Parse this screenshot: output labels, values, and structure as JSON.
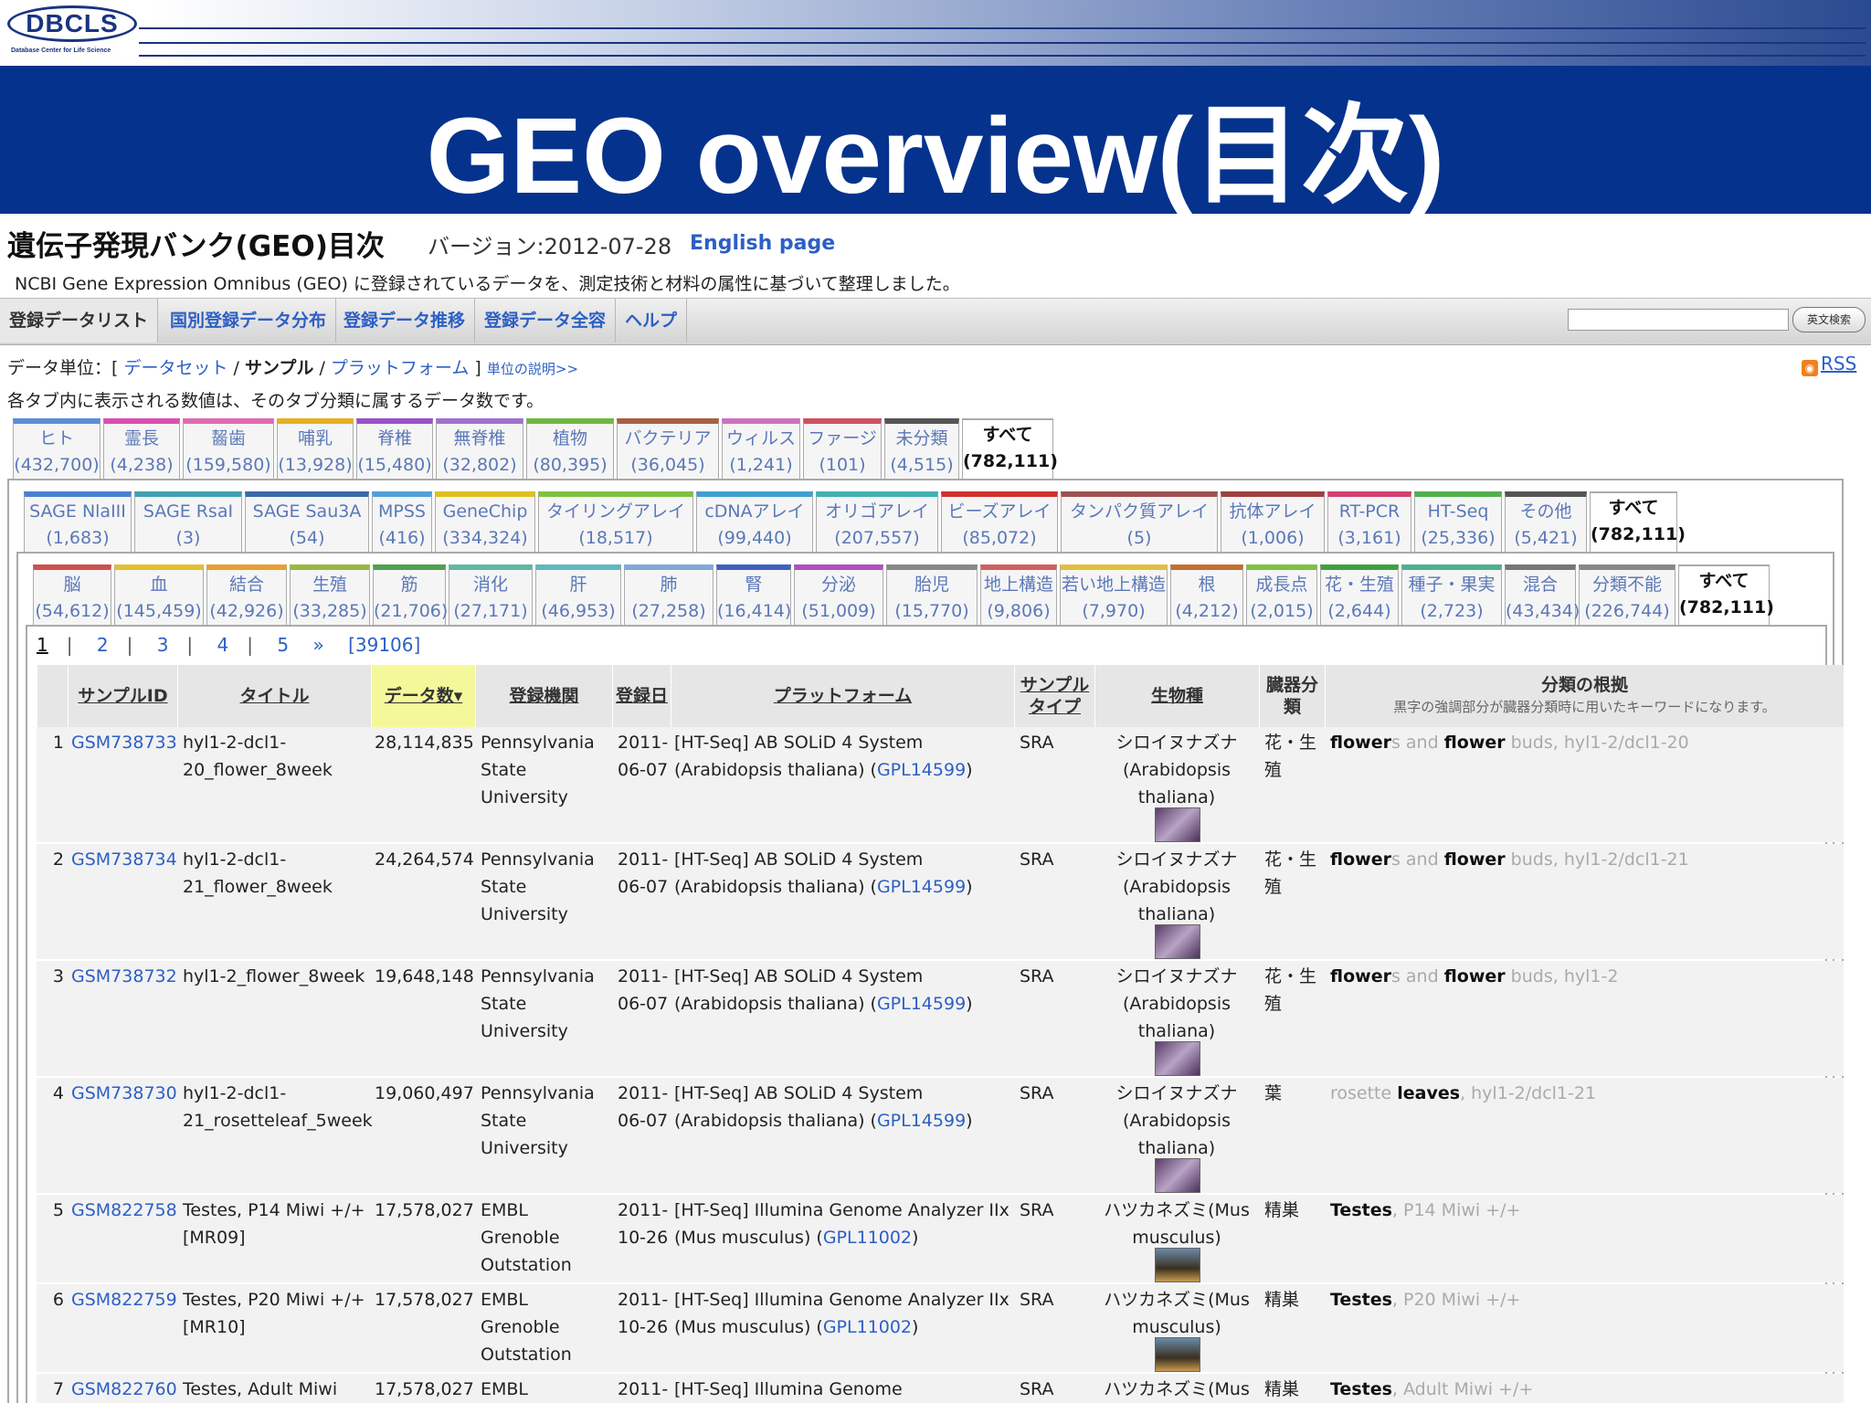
{
  "slide": {
    "logo_text": "DBCLS",
    "logo_sub": "Database Center for Life Science",
    "title": "GEO overview(目次)"
  },
  "page": {
    "heading": "遺伝子発現バンク(GEO)目次",
    "version": "バージョン:2012-07-28",
    "english_link": "English page",
    "description": "NCBI Gene Expression Omnibus (GEO) に登録されているデータを、測定技術と材料の属性に基づいて整理しました。",
    "nav": [
      "登録データリスト",
      "国別登録データ分布",
      "登録データ推移",
      "登録データ全容",
      "ヘルプ"
    ],
    "search_button": "英文検索",
    "unit_prefix": "データ単位：[",
    "unit_dataset": "データセット",
    "unit_slash1": "/",
    "unit_sample": "サンプル",
    "unit_slash2": "/",
    "unit_platform": "プラットフォーム",
    "unit_suffix": "]",
    "unit_help": "単位の説明>>",
    "rss": "RSS",
    "note": "各タブ内に表示される数値は、そのタブ分類に属するデータ数です。"
  },
  "organism_tabs": [
    {
      "label": "ヒト",
      "count": "(432,700)",
      "color": "#5b8ed6"
    },
    {
      "label": "霊長",
      "count": "(4,238)",
      "color": "#d94fb0"
    },
    {
      "label": "齧歯",
      "count": "(159,580)",
      "color": "#e06ab0"
    },
    {
      "label": "哺乳",
      "count": "(13,928)",
      "color": "#e8b020"
    },
    {
      "label": "脊椎",
      "count": "(15,480)",
      "color": "#9a50c8"
    },
    {
      "label": "無脊椎",
      "count": "(32,802)",
      "color": "#a070d0"
    },
    {
      "label": "植物",
      "count": "(80,395)",
      "color": "#70b840"
    },
    {
      "label": "バクテリア",
      "count": "(36,045)",
      "color": "#a86040"
    },
    {
      "label": "ウィルス",
      "count": "(1,241)",
      "color": "#d070c0"
    },
    {
      "label": "ファージ",
      "count": "(101)",
      "color": "#d05060"
    },
    {
      "label": "未分類",
      "count": "(4,515)",
      "color": "#555555"
    },
    {
      "label": "すべて",
      "count": "(782,111)",
      "color": "#aaaaaa"
    }
  ],
  "tech_tabs": [
    {
      "label": "SAGE NlaIII",
      "count": "(1,683)",
      "color": "#4a7fd0"
    },
    {
      "label": "SAGE RsaI",
      "count": "(3)",
      "color": "#40a0b0"
    },
    {
      "label": "SAGE Sau3A",
      "count": "(54)",
      "color": "#3a6aa8"
    },
    {
      "label": "MPSS",
      "count": "(416)",
      "color": "#50a0d8"
    },
    {
      "label": "GeneChip",
      "count": "(334,324)",
      "color": "#e0c020"
    },
    {
      "label": "タイリングアレイ",
      "count": "(18,517)",
      "color": "#80c040"
    },
    {
      "label": "cDNAアレイ",
      "count": "(99,440)",
      "color": "#40a0d0"
    },
    {
      "label": "オリゴアレイ",
      "count": "(207,557)",
      "color": "#40b0b0"
    },
    {
      "label": "ビーズアレイ",
      "count": "(85,072)",
      "color": "#d03030"
    },
    {
      "label": "タンパク質アレイ",
      "count": "(5)",
      "color": "#a05050"
    },
    {
      "label": "抗体アレイ",
      "count": "(1,006)",
      "color": "#a04040"
    },
    {
      "label": "RT-PCR",
      "count": "(3,161)",
      "color": "#d04070"
    },
    {
      "label": "HT-Seq",
      "count": "(25,336)",
      "color": "#50b050"
    },
    {
      "label": "その他",
      "count": "(5,421)",
      "color": "#555555"
    },
    {
      "label": "すべて",
      "count": "(782,111)",
      "color": "#aaaaaa"
    }
  ],
  "tissue_tabs": [
    {
      "label": "脳",
      "count": "(54,612)",
      "color": "#d05050"
    },
    {
      "label": "血",
      "count": "(145,459)",
      "color": "#e0c030"
    },
    {
      "label": "結合",
      "count": "(42,926)",
      "color": "#e8a030"
    },
    {
      "label": "生殖",
      "count": "(33,285)",
      "color": "#9ab840"
    },
    {
      "label": "筋",
      "count": "(21,706)",
      "color": "#50a050"
    },
    {
      "label": "消化",
      "count": "(27,171)",
      "color": "#60b8a0"
    },
    {
      "label": "肝",
      "count": "(46,953)",
      "color": "#60b8c0"
    },
    {
      "label": "肺",
      "count": "(27,258)",
      "color": "#80a8d8"
    },
    {
      "label": "腎",
      "count": "(16,414)",
      "color": "#4060c0"
    },
    {
      "label": "分泌",
      "count": "(51,009)",
      "color": "#b050c0"
    },
    {
      "label": "胎児",
      "count": "(15,770)",
      "color": "#888888"
    },
    {
      "label": "地上構造",
      "count": "(9,806)",
      "color": "#d06060"
    },
    {
      "label": "若い地上構造",
      "count": "(7,970)",
      "color": "#e0c040"
    },
    {
      "label": "根",
      "count": "(4,212)",
      "color": "#c07030"
    },
    {
      "label": "成長点",
      "count": "(2,015)",
      "color": "#80c040"
    },
    {
      "label": "花・生殖",
      "count": "(2,644)",
      "color": "#40a040"
    },
    {
      "label": "種子・果実",
      "count": "(2,723)",
      "color": "#50b090"
    },
    {
      "label": "混合",
      "count": "(43,434)",
      "color": "#777777"
    },
    {
      "label": "分類不能",
      "count": "(226,744)",
      "color": "#888888"
    },
    {
      "label": "すべて",
      "count": "(782,111)",
      "color": "#aaaaaa"
    }
  ],
  "pager": {
    "p1": "1",
    "sep": "|",
    "p2": "2",
    "p3": "3",
    "p4": "4",
    "p5": "5",
    "next": "»",
    "total": "[39106]"
  },
  "columns": {
    "sample_id": "サンプルID",
    "title": "タイトル",
    "data_count": "データ数",
    "sort_arrow": "▾",
    "institution": "登録機関",
    "date": "登録日",
    "platform": "プラットフォーム",
    "sample_type": "サンプルタイプ",
    "organism": "生物種",
    "organ": "臓器分類",
    "basis": "分類の根拠",
    "basis_note": "黒字の強調部分が臓器分類時に用いたキーワードになります。"
  },
  "rows": [
    {
      "n": "1",
      "id": "GSM738733",
      "title": "hyl1-2-dcl1-20_flower_8week",
      "count": "28,114,835",
      "inst": "Pennsylvania State University",
      "date": "2011-06-07",
      "platform_pre": "[HT-Seq] AB SOLiD 4 System (Arabidopsis thaliana) (",
      "platform_id": "GPL14599",
      "platform_post": ")",
      "stype": "SRA",
      "org": "シロイヌナズナ (Arabidopsis thaliana)",
      "organ": "花・生殖",
      "b1": "flower",
      "b2": "s and ",
      "b3": "flower",
      "b4": " buds, hyl1-2/dcl1-20",
      "thumb": "plant"
    },
    {
      "n": "2",
      "id": "GSM738734",
      "title": "hyl1-2-dcl1-21_flower_8week",
      "count": "24,264,574",
      "inst": "Pennsylvania State University",
      "date": "2011-06-07",
      "platform_pre": "[HT-Seq] AB SOLiD 4 System (Arabidopsis thaliana) (",
      "platform_id": "GPL14599",
      "platform_post": ")",
      "stype": "SRA",
      "org": "シロイヌナズナ (Arabidopsis thaliana)",
      "organ": "花・生殖",
      "b1": "flower",
      "b2": "s and ",
      "b3": "flower",
      "b4": " buds, hyl1-2/dcl1-21",
      "thumb": "plant"
    },
    {
      "n": "3",
      "id": "GSM738732",
      "title": "hyl1-2_flower_8week",
      "count": "19,648,148",
      "inst": "Pennsylvania State University",
      "date": "2011-06-07",
      "platform_pre": "[HT-Seq] AB SOLiD 4 System (Arabidopsis thaliana) (",
      "platform_id": "GPL14599",
      "platform_post": ")",
      "stype": "SRA",
      "org": "シロイヌナズナ (Arabidopsis thaliana)",
      "organ": "花・生殖",
      "b1": "flower",
      "b2": "s and ",
      "b3": "flower",
      "b4": " buds, hyl1-2",
      "thumb": "plant"
    },
    {
      "n": "4",
      "id": "GSM738730",
      "title": "hyl1-2-dcl1-21_rosetteleaf_5week",
      "count": "19,060,497",
      "inst": "Pennsylvania State University",
      "date": "2011-06-07",
      "platform_pre": "[HT-Seq] AB SOLiD 4 System (Arabidopsis thaliana) (",
      "platform_id": "GPL14599",
      "platform_post": ")",
      "stype": "SRA",
      "org": "シロイヌナズナ (Arabidopsis thaliana)",
      "organ": "葉",
      "b1": "",
      "b2": "rosette ",
      "b3": "leaves",
      "b4": ", hyl1-2/dcl1-21",
      "thumb": "plant"
    },
    {
      "n": "5",
      "id": "GSM822758",
      "title": "Testes, P14 Miwi +/+ [MR09]",
      "count": "17,578,027",
      "inst": "EMBL Grenoble Outstation",
      "date": "2011-10-26",
      "platform_pre": "[HT-Seq] Illumina Genome Analyzer IIx (Mus musculus) (",
      "platform_id": "GPL11002",
      "platform_post": ")",
      "stype": "SRA",
      "org": "ハツカネズミ(Mus musculus)",
      "organ": "精巣",
      "b1": "Testes",
      "b2": ", P14 Miwi +/+",
      "b3": "",
      "b4": "",
      "thumb": "mouse"
    },
    {
      "n": "6",
      "id": "GSM822759",
      "title": "Testes, P20 Miwi +/+ [MR10]",
      "count": "17,578,027",
      "inst": "EMBL Grenoble Outstation",
      "date": "2011-10-26",
      "platform_pre": "[HT-Seq] Illumina Genome Analyzer IIx (Mus musculus) (",
      "platform_id": "GPL11002",
      "platform_post": ")",
      "stype": "SRA",
      "org": "ハツカネズミ(Mus musculus)",
      "organ": "精巣",
      "b1": "Testes",
      "b2": ", P20 Miwi +/+",
      "b3": "",
      "b4": "",
      "thumb": "mouse"
    },
    {
      "n": "7",
      "id": "GSM822760",
      "title": "Testes, Adult Miwi",
      "count": "17,578,027",
      "inst": "EMBL",
      "date": "2011-",
      "platform_pre": "[HT-Seq] Illumina Genome",
      "platform_id": "",
      "platform_post": "",
      "stype": "SRA",
      "org": "ハツカネズミ(Mus",
      "organ": "精巣",
      "b1": "Testes",
      "b2": ", Adult Miwi +/+",
      "b3": "",
      "b4": "",
      "thumb": "none"
    }
  ]
}
